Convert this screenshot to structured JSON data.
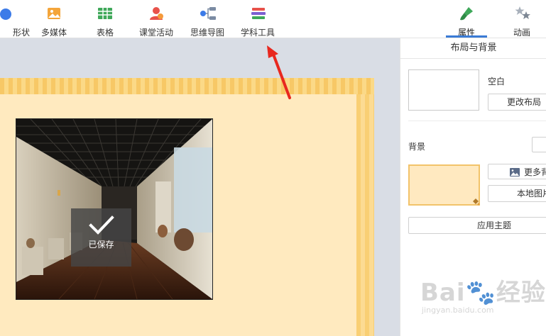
{
  "toolbar": {
    "items": [
      {
        "label": "形状",
        "icon": "shape-icon"
      },
      {
        "label": "多媒体",
        "icon": "multimedia-icon"
      },
      {
        "label": "表格",
        "icon": "table-icon"
      },
      {
        "label": "课堂活动",
        "icon": "classroom-activity-icon"
      },
      {
        "label": "思维导图",
        "icon": "mind-map-icon"
      },
      {
        "label": "学科工具",
        "icon": "subject-tools-icon"
      }
    ],
    "right_tabs": [
      {
        "label": "属性",
        "icon": "brush-icon",
        "active": true
      },
      {
        "label": "动画",
        "icon": "stars-icon",
        "active": false
      }
    ]
  },
  "canvas": {
    "saved_toast": "已保存",
    "slide_bg_color": "#ffeabf",
    "slide_border_color": "#f7c866"
  },
  "panel": {
    "title": "布局与背景",
    "layout_name": "空白",
    "change_layout_button": "更改布局",
    "background_label": "背景",
    "more_backgrounds_button": "更多背景",
    "local_image_button": "本地图片",
    "apply_theme_button": "应用主题"
  },
  "watermark": {
    "brand": "Bai🐾经验",
    "url": "jingyan.baidu.com"
  },
  "colors": {
    "accent": "#3a7bd5",
    "annotation_arrow": "#e8281f"
  }
}
